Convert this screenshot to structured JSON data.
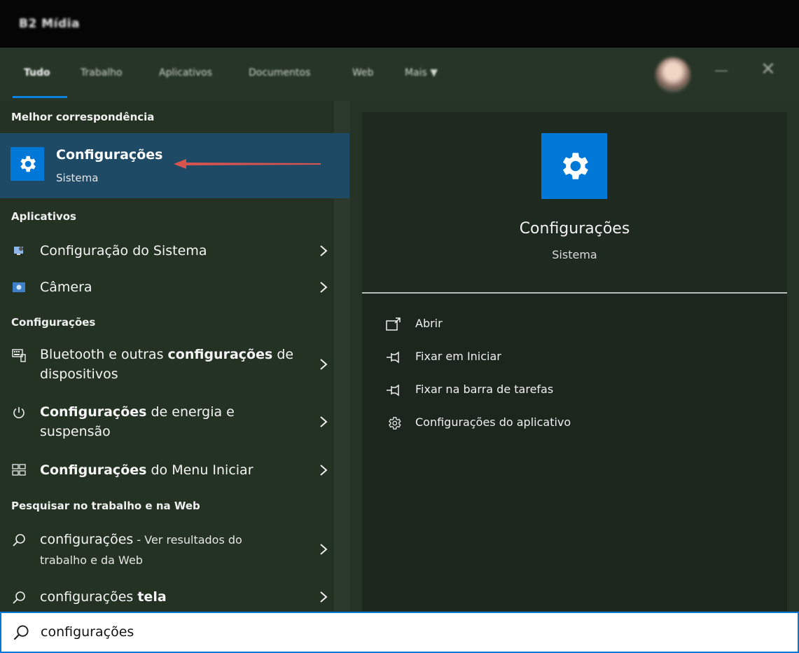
{
  "topbar": {
    "brand": "B2 Mídia"
  },
  "tabs": [
    {
      "label": "Tudo",
      "active": true
    },
    {
      "label": "Trabalho"
    },
    {
      "label": "Aplicativos"
    },
    {
      "label": "Documentos"
    },
    {
      "label": "Web"
    },
    {
      "label": "Mais ▼"
    }
  ],
  "window_controls": {
    "minimize": "—",
    "close": "✕"
  },
  "left": {
    "best_header": "Melhor correspondência",
    "best": {
      "title": "Configurações",
      "subtitle": "Sistema"
    },
    "apps_header": "Aplicativos",
    "apps": [
      {
        "label": "Configuração do Sistema",
        "icon": "system-config-icon"
      },
      {
        "label": "Câmera",
        "icon": "camera-icon"
      }
    ],
    "settings_header": "Configurações",
    "settings": [
      {
        "pre": "Bluetooth e outras ",
        "bold": "configurações",
        "post": " de",
        "line2": "dispositivos",
        "icon": "keyboard-icon"
      },
      {
        "pre": "",
        "bold": "Configurações",
        "post": " de energia e",
        "line2": "suspensão",
        "icon": "power-icon"
      },
      {
        "pre": "",
        "bold": "Configurações",
        "post": " do Menu Iniciar",
        "line2": "",
        "icon": "start-menu-icon"
      }
    ],
    "web_header": "Pesquisar no trabalho e na Web",
    "web": [
      {
        "main": "configurações",
        "suffix": " - Ver resultados do",
        "line2": "trabalho e da Web"
      },
      {
        "main": "configurações ",
        "bold": "tela"
      }
    ]
  },
  "right": {
    "title": "Configurações",
    "subtitle": "Sistema",
    "actions": [
      {
        "label": "Abrir",
        "icon": "open-icon"
      },
      {
        "label": "Fixar em Iniciar",
        "icon": "pin-icon"
      },
      {
        "label": "Fixar na barra de tarefas",
        "icon": "pin-taskbar-icon"
      },
      {
        "label": "Configurações do aplicativo",
        "icon": "gear-icon"
      }
    ]
  },
  "search": {
    "value": "configurações"
  },
  "colors": {
    "accent": "#0078d7",
    "selected": "#1f4a66",
    "arrow": "#d9534f"
  }
}
